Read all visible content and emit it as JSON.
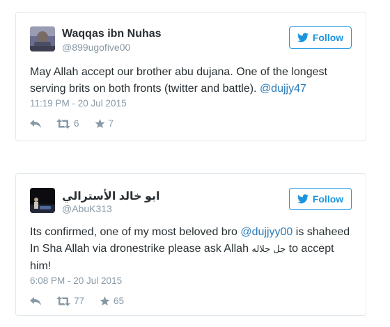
{
  "tweets": [
    {
      "display_name": "Waqqas ibn Nuhas",
      "handle": "@899ugofive00",
      "follow_label": "Follow",
      "text_before": "May Allah accept our brother abu dujana. One of the longest serving brits on both fronts (twitter and battle). ",
      "mention": "@dujjy47",
      "timestamp": "11:19 PM - 20 Jul 2015",
      "retweets": "6",
      "likes": "7"
    },
    {
      "display_name": "ابو خالد الأسترالي",
      "handle": "@AbuK313",
      "follow_label": "Follow",
      "text_before": "Its confirmed, one of my most beloved bro ",
      "mention": "@dujjyy00",
      "text_middle": " is shaheed In Sha Allah via dronestrike please ask Allah ",
      "arabic_phrase": "جل جلاله",
      "text_after": " to accept him!",
      "timestamp": "6:08 PM - 20 Jul 2015",
      "retweets": "77",
      "likes": "65"
    }
  ],
  "icons": {
    "reply": "reply-icon",
    "retweet": "retweet-icon",
    "like": "star-icon",
    "follow": "twitter-bird-icon"
  },
  "colors": {
    "accent": "#1b95e0",
    "mention": "#2b7bb9",
    "muted": "#8899a6",
    "text": "#292f33",
    "border": "#e1e8ed"
  }
}
